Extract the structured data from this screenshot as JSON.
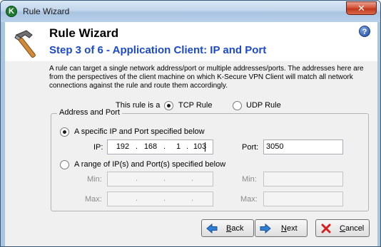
{
  "window": {
    "title": "Rule Wizard",
    "close_glyph": "✕",
    "app_icon_letter": "K"
  },
  "header": {
    "title": "Rule Wizard",
    "step": "Step 3 of 6 - Application Client: IP and Port",
    "help_glyph": "?",
    "icon": "hammer-icon"
  },
  "description": "A rule can target a single network address/port or multiple addresses/ports. The addresses here are from the perspectives of the client machine on which K-Secure VPN Client will match all network connections against the rule and route them accordingly.",
  "rule_type": {
    "label": "This rule is a",
    "options": [
      {
        "label": "TCP Rule",
        "selected": true
      },
      {
        "label": "UDP Rule",
        "selected": false
      }
    ]
  },
  "address_group": {
    "legend": "Address and Port",
    "single": {
      "label": "A specific IP and Port specified below",
      "selected": true,
      "ip_label": "IP:",
      "ip_octets": [
        "192",
        "168",
        "1",
        "103"
      ],
      "port_label": "Port:",
      "port_value": "3050"
    },
    "range": {
      "label": "A range of IP(s) and Port(s) specified below",
      "selected": false,
      "min_label": "Min:",
      "max_label": "Max:",
      "ip_min_octets": [
        "",
        "",
        "",
        ""
      ],
      "ip_max_octets": [
        "",
        "",
        "",
        ""
      ],
      "port_min_value": "",
      "port_max_value": ""
    }
  },
  "buttons": {
    "back": {
      "prefix": "",
      "accel": "B",
      "suffix": "ack",
      "icon": "arrow-left-icon"
    },
    "next": {
      "prefix": "",
      "accel": "N",
      "suffix": "ext",
      "icon": "arrow-right-icon"
    },
    "cancel": {
      "prefix": "",
      "accel": "C",
      "suffix": "ancel",
      "icon": "red-x-icon"
    }
  },
  "colors": {
    "step_title": "#1c4ac8",
    "close_button": "#c0381b",
    "arrow_blue": "#2f7fd8",
    "cancel_red": "#d42020"
  }
}
